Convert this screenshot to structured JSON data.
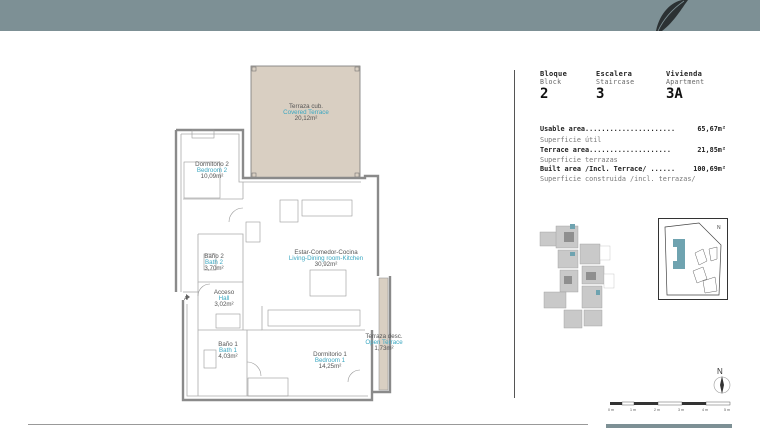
{
  "header": {
    "bar_color": "#7d9095"
  },
  "plan": {
    "rooms": [
      {
        "es": "Terraza cub.",
        "en": "Covered Terrace",
        "area": "20,12m²"
      },
      {
        "es": "Dormitorio 2",
        "en": "Bedroom 2",
        "area": "10,09m²"
      },
      {
        "es": "Estar-Comedor-Cocina",
        "en": "Living-Dining room-Kitchen",
        "area": "30,92m²"
      },
      {
        "es": "Baño 2",
        "en": "Bath 2",
        "area": "3,70m²"
      },
      {
        "es": "Acceso",
        "en": "Hall",
        "area": "3,02m²"
      },
      {
        "es": "Terraza desc.",
        "en": "Open Terrace",
        "area": "1,73m²"
      },
      {
        "es": "Baño 1",
        "en": "Bath 1",
        "area": "4,03m²"
      },
      {
        "es": "Dormitorio 1",
        "en": "Bedroom 1",
        "area": "14,25m²"
      }
    ],
    "entry_marker": "A",
    "accent_color": "#3aa7c1",
    "terrace_color": "#d9cfc2"
  },
  "info": {
    "block": {
      "label": "Bloque",
      "sub": "Block",
      "value": "2"
    },
    "staircase": {
      "label": "Escalera",
      "sub": "Staircase",
      "value": "3"
    },
    "dwelling": {
      "label": "Vivienda",
      "sub": "Apartment",
      "value": "3A"
    },
    "usable": {
      "label": "Usable area......................",
      "value": "65,67m²",
      "sub": "Superficie útil"
    },
    "terrace": {
      "label": "Terrace area....................",
      "value": "21,85m²",
      "sub": "Superficie terrazas"
    },
    "built": {
      "label": "Built area /Incl. Terrace/ ......",
      "value": "100,69m²",
      "sub": "Superficie construida /incl. terrazas/"
    }
  },
  "north_label": "N",
  "scale": {
    "labels": [
      "0 m",
      "1 m",
      "2 m",
      "3 m",
      "4 m",
      "5 m"
    ]
  }
}
